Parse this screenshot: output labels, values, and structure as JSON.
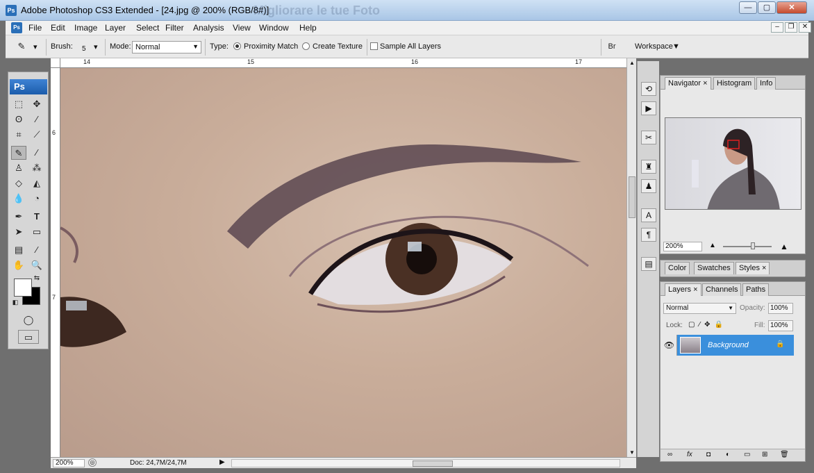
{
  "titlebar": {
    "title": "Adobe Photoshop CS3 Extended - [24.jpg @ 200% (RGB/8#)]",
    "ghost_title": "Migliorare le tue Foto",
    "logo": "Ps",
    "minimize": "—",
    "maximize": "▢",
    "close": "✕"
  },
  "menubar": {
    "logo": "Ps",
    "items": [
      "File",
      "Edit",
      "Image",
      "Layer",
      "Select",
      "Filter",
      "Analysis",
      "View",
      "Window",
      "Help"
    ],
    "mdi": [
      "–",
      "❐",
      "✕"
    ]
  },
  "options": {
    "brush_label": "Brush:",
    "brush_size": "5",
    "mode_label": "Mode:",
    "mode_value": "Normal",
    "type_label": "Type:",
    "radio_proximity": "Proximity Match",
    "radio_texture": "Create Texture",
    "check_sample": "Sample All Layers",
    "workspace": "Workspace"
  },
  "toolbox": {
    "logo": "Ps"
  },
  "rulers": {
    "top": [
      "14",
      "15",
      "16",
      "17"
    ],
    "left": [
      "6",
      "7"
    ]
  },
  "status": {
    "zoom": "200%",
    "doc": "Doc: 24,7M/24,7M"
  },
  "navigator": {
    "tabs": [
      "Navigator",
      "Histogram",
      "Info"
    ],
    "zoom": "200%"
  },
  "styles_panel": {
    "tabs": [
      "Color",
      "Swatches",
      "Styles"
    ]
  },
  "layers": {
    "tabs": [
      "Layers",
      "Channels",
      "Paths"
    ],
    "blend_mode": "Normal",
    "opacity_label": "Opacity:",
    "opacity_value": "100%",
    "lock_label": "Lock:",
    "fill_label": "Fill:",
    "fill_value": "100%",
    "layer_name": "Background",
    "footer_icons": [
      "∞",
      "fx",
      "◘",
      "◐",
      "▭",
      "⊞",
      "🗑"
    ]
  }
}
